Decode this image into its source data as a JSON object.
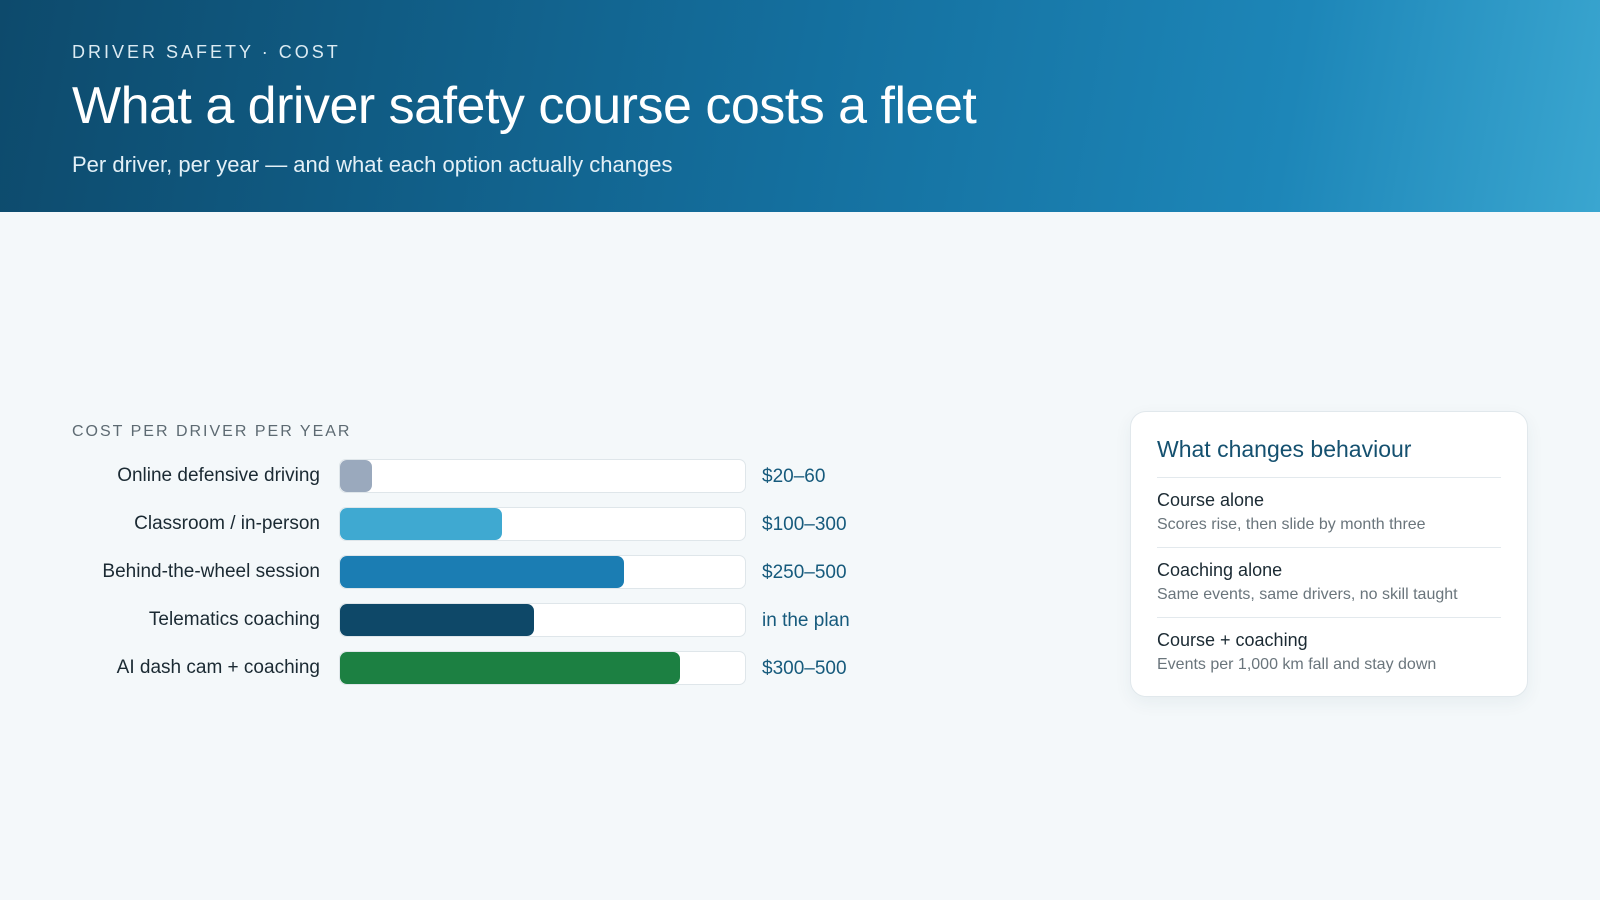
{
  "header": {
    "eyebrow": "DRIVER SAFETY · COST",
    "title": "What a driver safety course costs a fleet",
    "subtitle": "Per driver, per year — and what each option actually changes"
  },
  "chart_data": {
    "type": "bar",
    "orientation": "horizontal",
    "title": "COST PER DRIVER PER YEAR",
    "categories": [
      "Online defensive driving",
      "Classroom / in-person",
      "Behind-the-wheel session",
      "Telematics coaching",
      "AI dash cam + coaching"
    ],
    "value_labels": [
      "$20–60",
      "$100–300",
      "$250–500",
      "in the plan",
      "$300–500"
    ],
    "values": [
      0.08,
      0.4,
      0.7,
      0.48,
      0.84
    ],
    "colors": [
      "#9aa9bd",
      "#3fa9d1",
      "#1b7db3",
      "#0e4868",
      "#1c8042"
    ],
    "grid": false,
    "legend": "none"
  },
  "card": {
    "title": "What changes behaviour",
    "items": [
      {
        "head": "Course alone",
        "desc": "Scores rise, then slide by month three"
      },
      {
        "head": "Coaching alone",
        "desc": "Same events, same drivers, no skill taught"
      },
      {
        "head": "Course + coaching",
        "desc": "Events per 1,000 km fall and stay down"
      }
    ]
  }
}
